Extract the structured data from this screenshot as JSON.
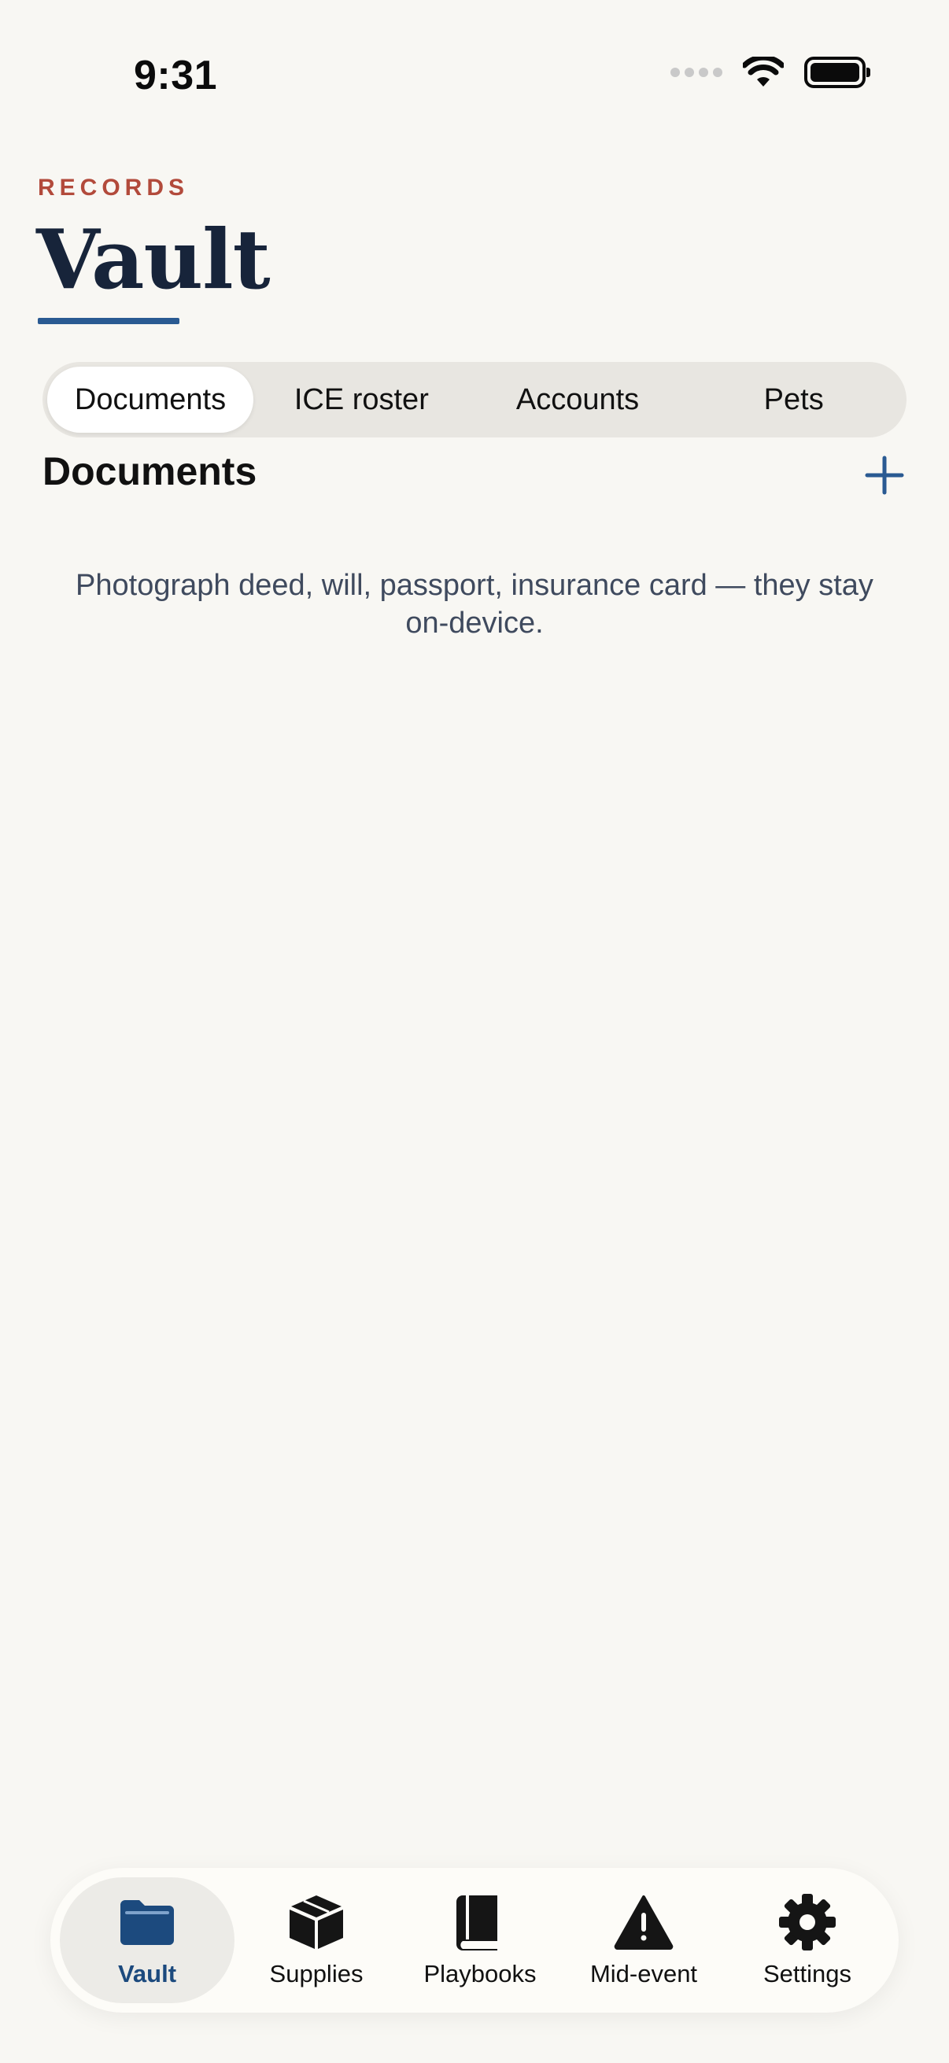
{
  "status_bar": {
    "time": "9:31"
  },
  "header": {
    "eyebrow": "RECORDS",
    "title": "Vault"
  },
  "segments": [
    {
      "label": "Documents",
      "selected": true
    },
    {
      "label": "ICE roster",
      "selected": false
    },
    {
      "label": "Accounts",
      "selected": false
    },
    {
      "label": "Pets",
      "selected": false
    }
  ],
  "section": {
    "title": "Documents",
    "add_icon": "plus-icon",
    "empty_message": "Photograph deed, will, passport, insurance card — they stay on-device."
  },
  "tabbar": [
    {
      "label": "Vault",
      "icon": "folder-icon",
      "selected": true
    },
    {
      "label": "Supplies",
      "icon": "box-icon",
      "selected": false
    },
    {
      "label": "Playbooks",
      "icon": "book-icon",
      "selected": false
    },
    {
      "label": "Mid-event",
      "icon": "warning-icon",
      "selected": false
    },
    {
      "label": "Settings",
      "icon": "gear-icon",
      "selected": false
    }
  ],
  "colors": {
    "accent": "#2a5a92",
    "eyebrow": "#b24a3b",
    "title": "#17243a",
    "background": "#f8f7f3"
  }
}
